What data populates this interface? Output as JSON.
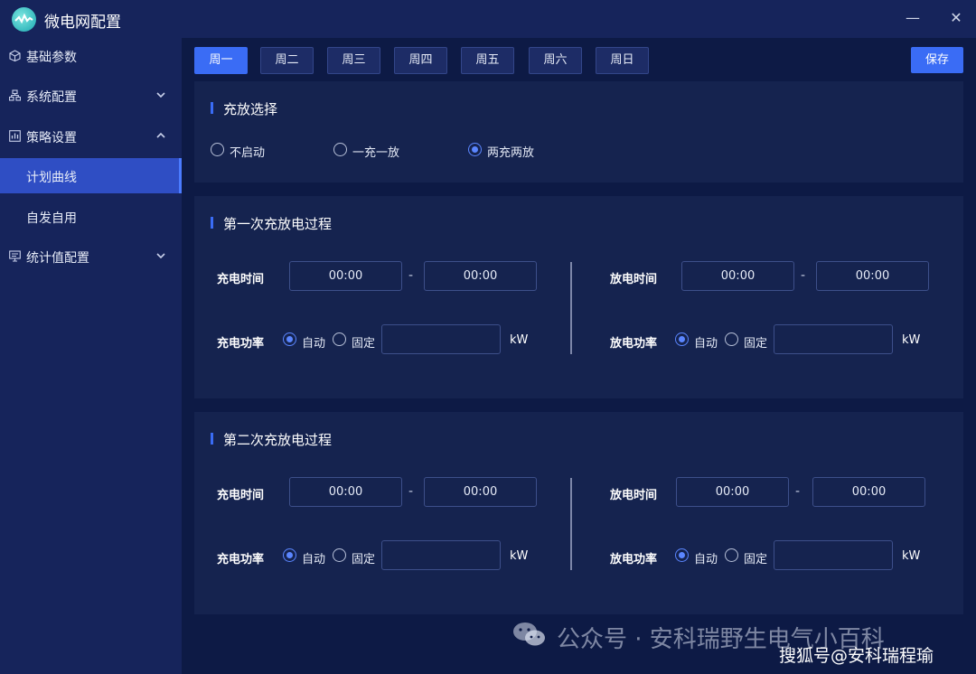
{
  "window": {
    "title": "微电网配置",
    "minimize": "—",
    "close": "✕"
  },
  "sidebar": {
    "items": [
      {
        "label": "基础参数",
        "icon": "cube-icon"
      },
      {
        "label": "系统配置",
        "icon": "network-icon"
      },
      {
        "label": "策略设置",
        "icon": "strategy-icon"
      },
      {
        "label": "计划曲线"
      },
      {
        "label": "自发自用"
      },
      {
        "label": "统计值配置",
        "icon": "monitor-icon"
      }
    ],
    "active": "计划曲线"
  },
  "tabs": [
    "周一",
    "周二",
    "周三",
    "周四",
    "周五",
    "周六",
    "周日"
  ],
  "active_tab": "周一",
  "save_label": "保存",
  "charge_mode": {
    "title": "充放选择",
    "options": [
      "不启动",
      "一充一放",
      "两充两放"
    ],
    "selected": "两充两放"
  },
  "process1": {
    "title": "第一次充放电过程",
    "charge_time_label": "充电时间",
    "charge_start": "00:00",
    "charge_end": "00:00",
    "charge_power_label": "充电功率",
    "discharge_time_label": "放电时间",
    "discharge_start": "00:00",
    "discharge_end": "00:00",
    "discharge_power_label": "放电功率",
    "auto_label": "自动",
    "fixed_label": "固定",
    "unit": "kW",
    "dash": "-"
  },
  "process2": {
    "title": "第二次充放电过程",
    "charge_time_label": "充电时间",
    "charge_start": "00:00",
    "charge_end": "00:00",
    "charge_power_label": "充电功率",
    "discharge_time_label": "放电时间",
    "discharge_start": "00:00",
    "discharge_end": "00:00",
    "discharge_power_label": "放电功率",
    "auto_label": "自动",
    "fixed_label": "固定",
    "unit": "kW",
    "dash": "-"
  },
  "watermark": {
    "line1": "公众号 · 安科瑞野生电气小百科",
    "line2": "搜狐号@安科瑞程瑜"
  }
}
